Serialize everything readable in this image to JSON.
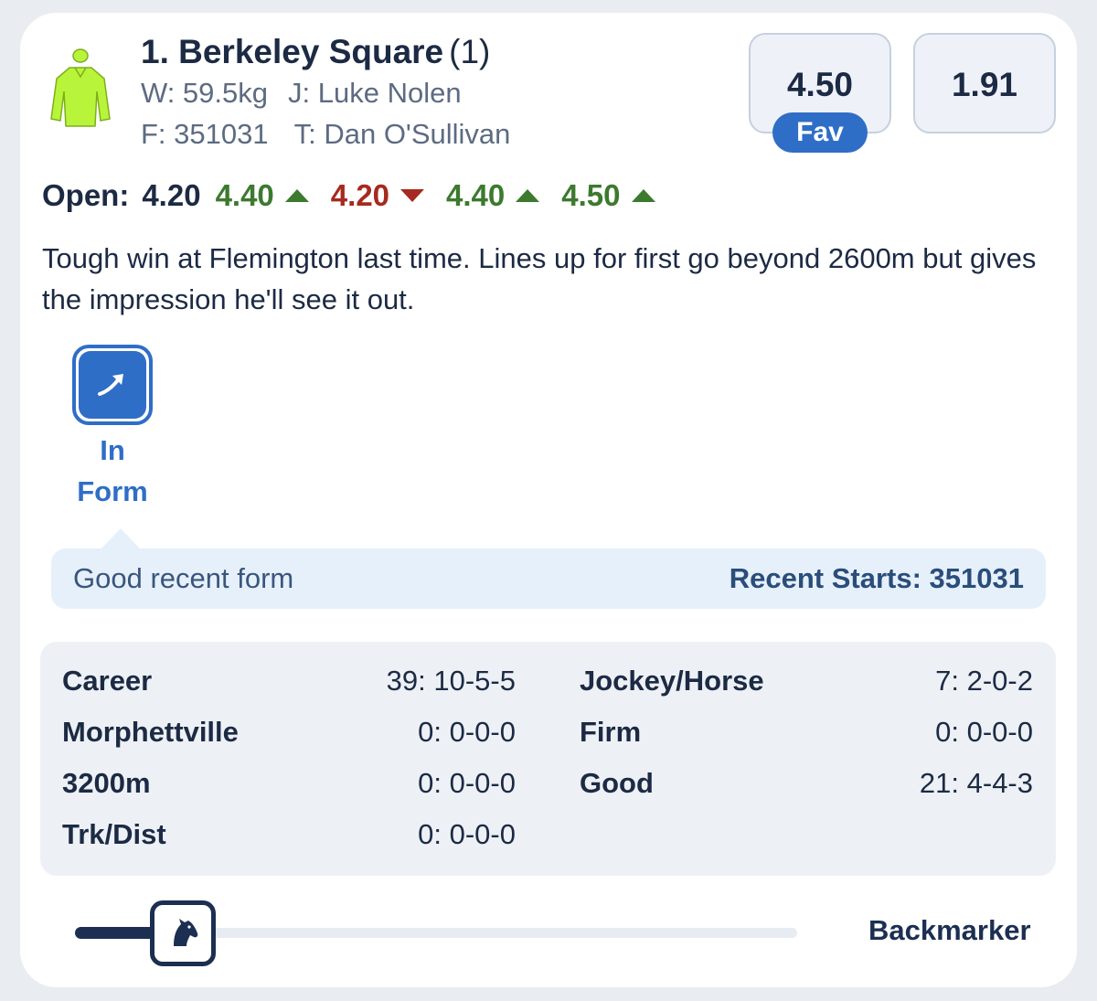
{
  "runner": {
    "name": "1. Berkeley Square",
    "barrier": "(1)",
    "weight": "W: 59.5kg",
    "jockey": "J: Luke Nolen",
    "form": "F: 351031",
    "trainer": "T: Dan O'Sullivan",
    "silks_icon": "jockey-silks-icon",
    "silks_color": "#b8f53a"
  },
  "prices": {
    "win": "4.50",
    "place": "1.91",
    "fav_label": "Fav"
  },
  "flucs": {
    "open_label": "Open:",
    "open_value": "4.20",
    "moves": [
      {
        "value": "4.40",
        "direction": "up"
      },
      {
        "value": "4.20",
        "direction": "down"
      },
      {
        "value": "4.40",
        "direction": "up"
      },
      {
        "value": "4.50",
        "direction": "up"
      }
    ],
    "up_color": "#3c7a2e",
    "down_color": "#a62a1f"
  },
  "comment": "Tough win at Flemington last time. Lines up for first go beyond 2600m but gives the impression he'll see it out.",
  "form_badge": {
    "icon": "trending-up-arrow-icon",
    "label_line1": "In",
    "label_line2": "Form",
    "description": "Good recent form",
    "recent_starts": "Recent Starts: 351031",
    "accent": "#2f6ec7"
  },
  "stats": {
    "left": [
      {
        "label": "Career",
        "value": "39: 10-5-5"
      },
      {
        "label": "Morphettville",
        "value": "0: 0-0-0"
      },
      {
        "label": "3200m",
        "value": "0: 0-0-0"
      },
      {
        "label": "Trk/Dist",
        "value": "0: 0-0-0"
      }
    ],
    "right": [
      {
        "label": "Jockey/Horse",
        "value": "7: 2-0-2"
      },
      {
        "label": "Firm",
        "value": "0: 0-0-0"
      },
      {
        "label": "Good",
        "value": "21: 4-4-3"
      }
    ]
  },
  "speed_map": {
    "position_label": "Backmarker",
    "marker_icon": "horse-head-icon",
    "position_fraction": 0.16
  }
}
